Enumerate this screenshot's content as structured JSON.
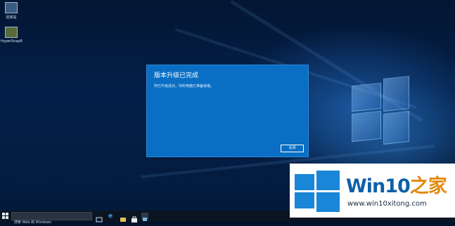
{
  "desktop": {
    "icons": [
      {
        "label": "回收站",
        "icon": "recycle-bin-icon"
      },
      {
        "label": "HyperSnap8",
        "icon": "hypersnap-app-icon"
      }
    ]
  },
  "dialog": {
    "title": "版本升级已完成",
    "message": "你已升级成功，你的电脑已准备就绪。",
    "close_label": "关闭"
  },
  "taskbar": {
    "search_placeholder": "搜索 Web 和 Windows",
    "pinned": [
      "task-view-icon",
      "edge-browser-icon",
      "file-explorer-icon",
      "store-icon",
      "remote-desktop-icon"
    ]
  },
  "watermark": {
    "brand_prefix": "Win10",
    "brand_suffix": "之家",
    "url": "www.win10xitong.com",
    "colors": {
      "logo": "#1a86d8",
      "brand": "#0f5fa8",
      "accent": "#e38a12"
    }
  },
  "colors": {
    "dialog_bg": "#0a6fc4",
    "desktop_bg": "#031a3b",
    "taskbar_bg": "#0b1522"
  }
}
